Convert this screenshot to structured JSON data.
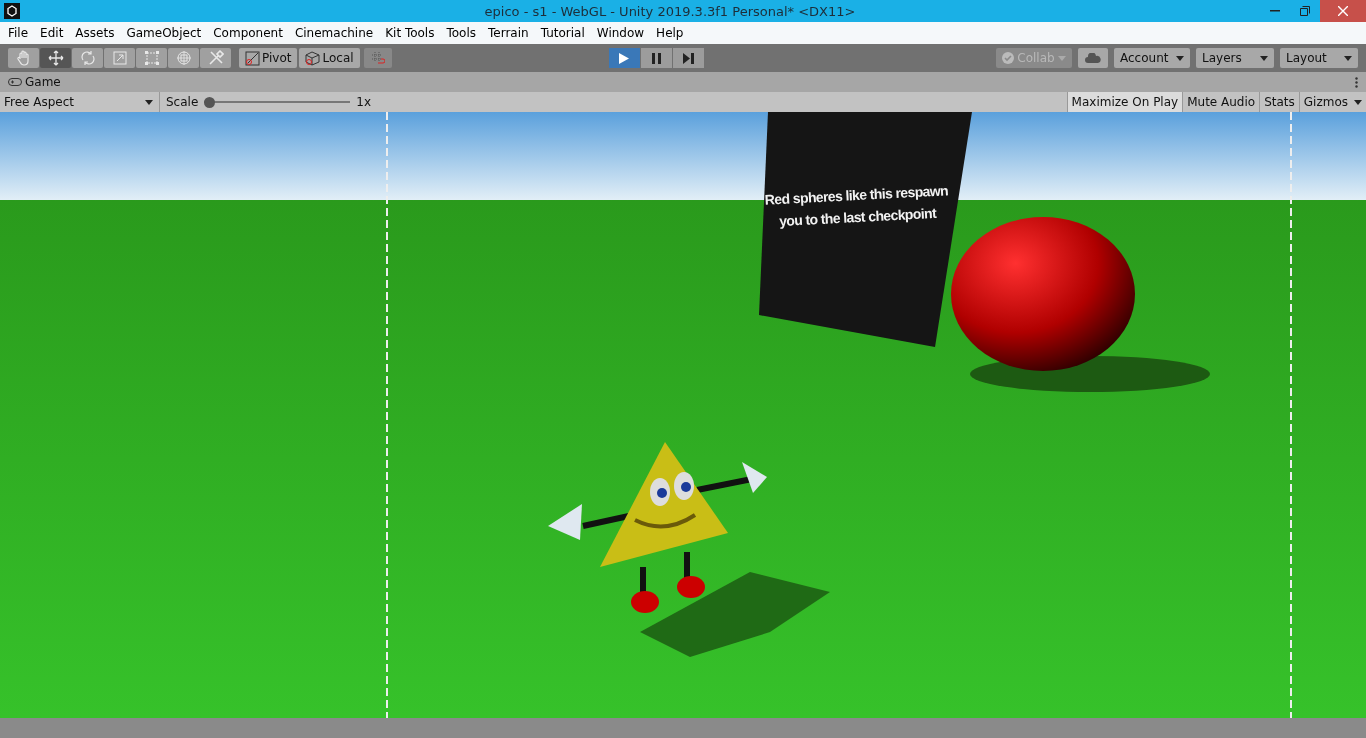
{
  "window": {
    "title": "epico - s1 - WebGL - Unity 2019.3.3f1 Personal* <DX11>"
  },
  "menu": [
    "File",
    "Edit",
    "Assets",
    "GameObject",
    "Component",
    "Cinemachine",
    "Kit Tools",
    "Tools",
    "Terrain",
    "Tutorial",
    "Window",
    "Help"
  ],
  "tools": [
    {
      "kind": "hand",
      "selected": false
    },
    {
      "kind": "move",
      "selected": true
    },
    {
      "kind": "rotate",
      "selected": false
    },
    {
      "kind": "scale",
      "selected": false
    },
    {
      "kind": "rect",
      "selected": false
    },
    {
      "kind": "transform",
      "selected": false
    },
    {
      "kind": "custom",
      "selected": false
    }
  ],
  "handle_buttons": [
    {
      "kind": "pivot",
      "label": "Pivot"
    },
    {
      "kind": "local",
      "label": "Local"
    }
  ],
  "playback": [
    {
      "kind": "play",
      "selected": true
    },
    {
      "kind": "pause",
      "selected": false
    },
    {
      "kind": "step",
      "selected": false
    }
  ],
  "collab": {
    "label": "Collab",
    "disabled": true
  },
  "dropdowns": [
    "Account",
    "Layers",
    "Layout"
  ],
  "game_tab": {
    "title": "Game"
  },
  "game_toolbar": {
    "aspect": "Free Aspect",
    "scale_label": "Scale",
    "scale": {
      "level": 0
    },
    "scale_value": "1x",
    "toggles": [
      {
        "label": "Maximize On Play",
        "on": true,
        "dropdown": false
      },
      {
        "label": "Mute Audio",
        "on": false,
        "dropdown": false
      },
      {
        "label": "Stats",
        "on": false,
        "dropdown": false
      },
      {
        "label": "Gizmos",
        "on": false,
        "dropdown": true
      }
    ]
  },
  "game_view": {
    "sign_lines": [
      "Red spheres like this respawn",
      "you to the last checkpoint"
    ]
  }
}
